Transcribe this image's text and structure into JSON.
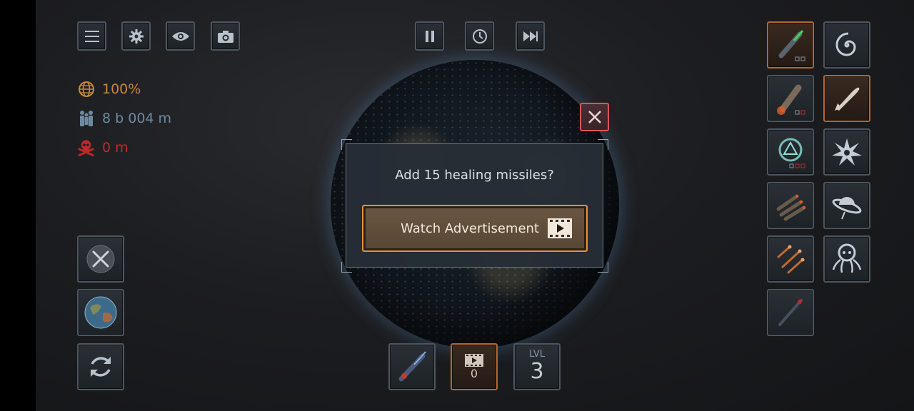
{
  "top_bar": {
    "menu_icon": "menu-icon",
    "settings_icon": "gear-icon",
    "view_icon": "eye-icon",
    "screenshot_icon": "camera-icon",
    "pause_icon": "pause-icon",
    "speed_icon": "clock-icon",
    "fast_forward_icon": "fast-forward-icon"
  },
  "stats": {
    "planet_health": "100%",
    "population": "8 b 004 m",
    "deaths": "0 m"
  },
  "dialog": {
    "question": "Add 15 healing missiles?",
    "watch_label": "Watch Advertisement"
  },
  "bottom_bar": {
    "ad_count": "0",
    "level_caption": "LVL",
    "level_value": "3"
  },
  "colors": {
    "accent_orange": "#e6923a",
    "close_red": "#d9575b",
    "health_text": "#c8883a",
    "population_text": "#6f8aa0",
    "deaths_text": "#c0282a"
  }
}
